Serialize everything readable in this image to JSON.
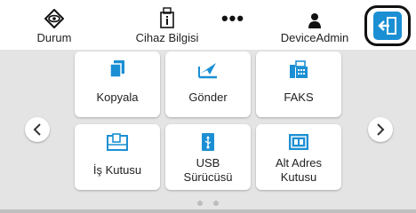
{
  "header": {
    "durum_label": "Durum",
    "cihaz_label": "Cihaz Bilgisi",
    "more_label": "•••",
    "admin_label": "DeviceAdmin"
  },
  "tiles": [
    {
      "label": "Kopyala",
      "icon": "copy-icon"
    },
    {
      "label": "Gönder",
      "icon": "send-icon"
    },
    {
      "label": "FAKS",
      "icon": "fax-icon"
    },
    {
      "label": "İş Kutusu",
      "icon": "job-box-icon"
    },
    {
      "label": "USB\nSürücüsü",
      "icon": "usb-drive-icon"
    },
    {
      "label": "Alt Adres\nKutusu",
      "icon": "subaddress-box-icon"
    }
  ],
  "pagination": {
    "pages": 2,
    "current": 1
  },
  "colors": {
    "accent": "#1b8fd4",
    "background": "#e4e4e4",
    "tile": "#ffffff"
  }
}
